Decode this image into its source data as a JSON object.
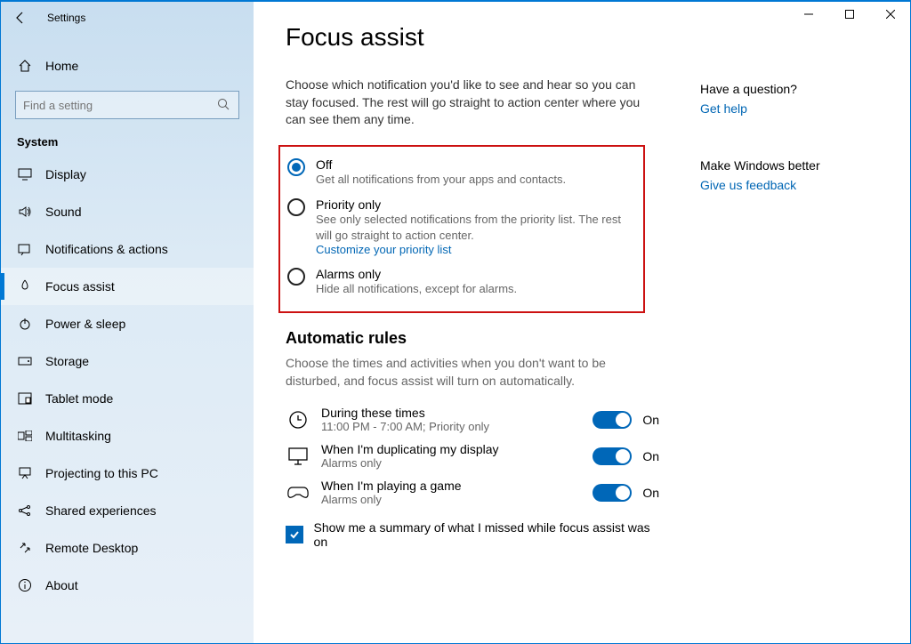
{
  "window": {
    "title": "Settings"
  },
  "home_label": "Home",
  "search": {
    "placeholder": "Find a setting"
  },
  "section": "System",
  "nav": [
    {
      "label": "Display"
    },
    {
      "label": "Sound"
    },
    {
      "label": "Notifications & actions"
    },
    {
      "label": "Focus assist"
    },
    {
      "label": "Power & sleep"
    },
    {
      "label": "Storage"
    },
    {
      "label": "Tablet mode"
    },
    {
      "label": "Multitasking"
    },
    {
      "label": "Projecting to this PC"
    },
    {
      "label": "Shared experiences"
    },
    {
      "label": "Remote Desktop"
    },
    {
      "label": "About"
    }
  ],
  "page": {
    "title": "Focus assist",
    "intro": "Choose which notification you'd like to see and hear so you can stay focused. The rest will go straight to action center where you can see them any time.",
    "radios": {
      "off": {
        "title": "Off",
        "desc": "Get all notifications from your apps and contacts."
      },
      "priority": {
        "title": "Priority only",
        "desc": "See only selected notifications from the priority list. The rest will go straight to action center.",
        "link": "Customize your priority list"
      },
      "alarms": {
        "title": "Alarms only",
        "desc": "Hide all notifications, except for alarms."
      }
    },
    "auto": {
      "heading": "Automatic rules",
      "desc": "Choose the times and activities when you don't want to be disturbed, and focus assist will turn on automatically.",
      "rules": [
        {
          "title": "During these times",
          "sub": "11:00 PM - 7:00 AM; Priority only",
          "state": "On"
        },
        {
          "title": "When I'm duplicating my display",
          "sub": "Alarms only",
          "state": "On"
        },
        {
          "title": "When I'm playing a game",
          "sub": "Alarms only",
          "state": "On"
        }
      ],
      "summary_chk": "Show me a summary of what I missed while focus assist was on"
    }
  },
  "side": {
    "q1": "Have a question?",
    "l1": "Get help",
    "q2": "Make Windows better",
    "l2": "Give us feedback"
  }
}
